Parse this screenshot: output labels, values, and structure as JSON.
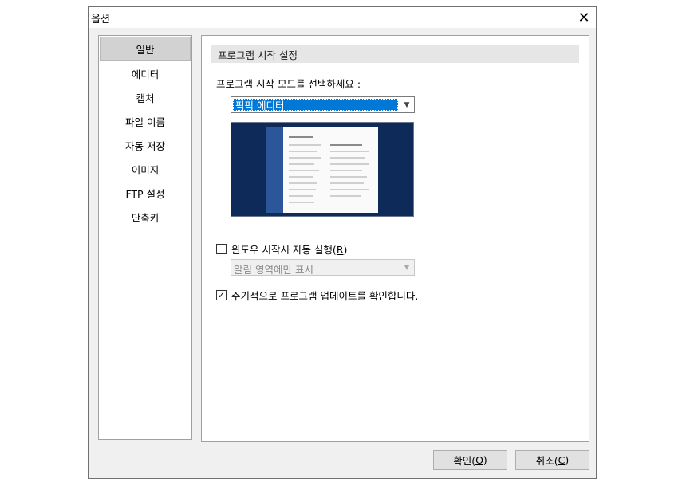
{
  "window": {
    "title": "옵션"
  },
  "sidebar": {
    "items": [
      {
        "label": "일반",
        "selected": true
      },
      {
        "label": "에디터"
      },
      {
        "label": "캡처"
      },
      {
        "label": "파일 이름"
      },
      {
        "label": "자동 저장"
      },
      {
        "label": "이미지"
      },
      {
        "label": "FTP 설정"
      },
      {
        "label": "단축키"
      }
    ]
  },
  "main": {
    "section_title": "프로그램 시작 설정",
    "mode_label": "프로그램 시작 모드를 선택하세요 :",
    "mode_select": {
      "value": "픽픽 에디터"
    },
    "autostart": {
      "label_prefix": "윈도우 시작시 자동 실행(",
      "accel": "R",
      "label_suffix": ")",
      "checked": false
    },
    "tray_select": {
      "value": "알림 영역에만 표시",
      "disabled": true
    },
    "update_check": {
      "label": "주기적으로 프로그램 업데이트를 확인합니다.",
      "checked": true
    }
  },
  "footer": {
    "ok": {
      "prefix": "확인(",
      "accel": "O",
      "suffix": ")"
    },
    "cancel": {
      "prefix": "취소(",
      "accel": "C",
      "suffix": ")"
    }
  },
  "colors": {
    "accent": "#0078d7",
    "preview_bg": "#0e2a59",
    "sidebar_selected": "#d2d2d2"
  }
}
